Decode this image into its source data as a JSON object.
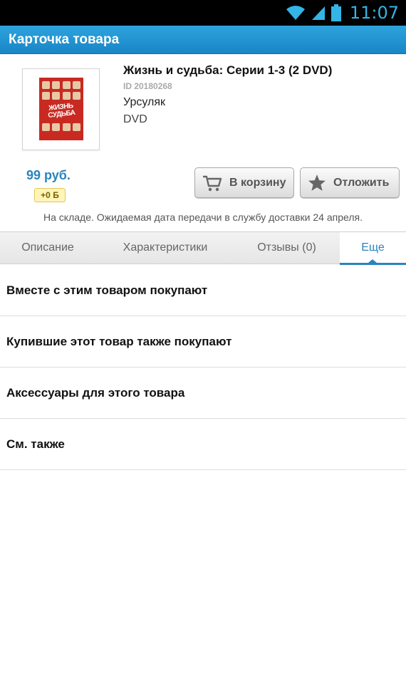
{
  "status_bar": {
    "time": "11:07",
    "icons": [
      "wifi-icon",
      "signal-icon",
      "battery-icon"
    ]
  },
  "app_bar": {
    "title": "Карточка товара"
  },
  "product": {
    "title": "Жизнь и судьба: Серии 1-3 (2 DVD)",
    "id": "ID 20180268",
    "author": "Урсуляк",
    "format": "DVD",
    "cover_title": "ЖИЗНЬ СУДЬБА",
    "price": "99 руб.",
    "bonus": "+0 Б",
    "stock_text": "На складе. Ожидаемая дата передачи в службу доставки 24 апреля."
  },
  "actions": {
    "cart_label": "В корзину",
    "later_label": "Отложить"
  },
  "tabs": [
    {
      "label": "Описание"
    },
    {
      "label": "Характеристики"
    },
    {
      "label": "Отзывы (0)"
    },
    {
      "label": "Еще"
    }
  ],
  "list": [
    {
      "label": "Вместе с этим товаром покупают"
    },
    {
      "label": "Купившие этот товар также покупают"
    },
    {
      "label": "Аксессуары для этого товара"
    },
    {
      "label": "См. также"
    }
  ],
  "colors": {
    "accent": "#2a84bd",
    "app_bar": "#1f90cf",
    "status_clock": "#33b5e5",
    "bonus_bg": "#fff5b8"
  }
}
